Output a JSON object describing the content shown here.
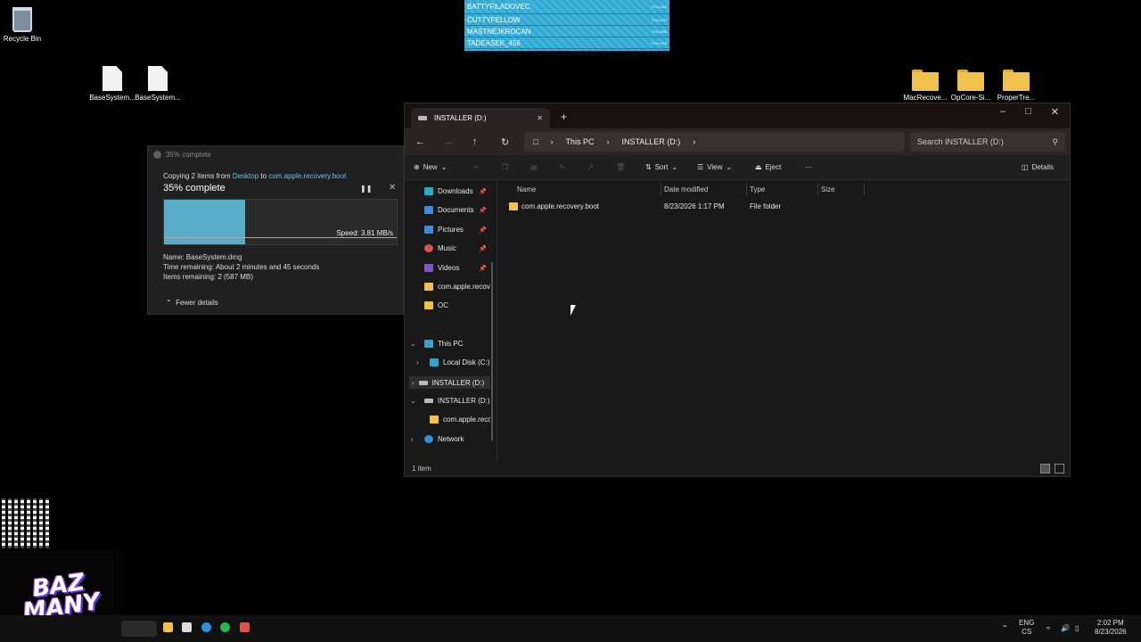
{
  "desktop": {
    "recycle_bin": "Recycle Bin",
    "files": [
      "BaseSystem...",
      "BaseSystem..."
    ],
    "folders": [
      "MacRecove...",
      "OpCore-Si...",
      "ProperTre..."
    ]
  },
  "overlay": {
    "follow_label": "FOLLOW",
    "names": [
      "BATTYFILADOVEC",
      "CUTTYFELLOW",
      "MASTNEJKROCAN",
      "TADEASEK_456"
    ]
  },
  "copy_dialog": {
    "title": "35% complete",
    "copying_prefix": "Copying 2 items from ",
    "source": "Desktop",
    "to": " to ",
    "destination": "com.apple.recovery.boot",
    "percent_label": "35% complete",
    "progress_fraction": 0.35,
    "speed": "Speed: 3.81 MB/s",
    "name": "Name: BaseSystem.dmg",
    "time_remaining": "Time remaining: About 2 minutes and 45 seconds",
    "items_remaining": "Items remaining: 2 (587 MB)",
    "fewer_details": "Fewer details"
  },
  "explorer": {
    "tab_title": "INSTALLER (D:)",
    "breadcrumb": [
      "This PC",
      "INSTALLER (D:)"
    ],
    "search_placeholder": "Search INSTALLER (D:)",
    "commands": {
      "new": "New",
      "sort": "Sort",
      "view": "View",
      "eject": "Eject",
      "more": "···",
      "details": "Details"
    },
    "nav": {
      "quick": [
        "Downloads",
        "Documents",
        "Pictures",
        "Music",
        "Videos",
        "com.apple.recovery.boot",
        "OC"
      ],
      "this_pc": "This PC",
      "local_disk": "Local Disk (C:)",
      "installer_child": "INSTALLER (D:)",
      "installer": "INSTALLER (D:)",
      "installer_folder": "com.apple.recovery.boot",
      "network": "Network"
    },
    "columns": [
      "Name",
      "Date modified",
      "Type",
      "Size"
    ],
    "rows": [
      {
        "name": "com.apple.recovery.boot",
        "date": "8/23/2026 1:17 PM",
        "type": "File folder",
        "size": ""
      }
    ],
    "status": "1 item"
  },
  "logo_text": "BAZ MANY",
  "taskbar": {
    "lang": "ENG",
    "layout": "CS",
    "time": "2:02 PM",
    "date": "8/23/2026"
  }
}
